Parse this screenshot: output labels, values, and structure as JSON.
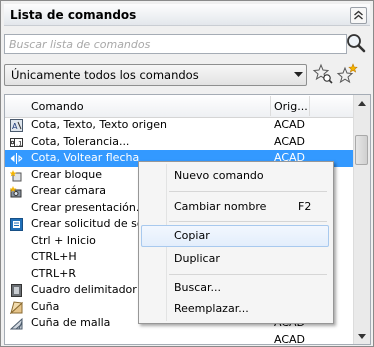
{
  "panel": {
    "title": "Lista de comandos"
  },
  "search": {
    "placeholder": "Buscar lista de comandos",
    "value": ""
  },
  "filter": {
    "selected": "Únicamente todos los comandos"
  },
  "list": {
    "columns": [
      "Comando",
      "Orig..."
    ],
    "rows": [
      {
        "command": "Cota, Texto, Texto origen",
        "origin": "ACAD",
        "icon": "dimension-text-icon"
      },
      {
        "command": "Cota, Tolerancia...",
        "origin": "ACAD",
        "icon": "tolerance-icon"
      },
      {
        "command": "Cota, Voltear flecha",
        "origin": "ACAD",
        "icon": "flip-arrow-icon",
        "selected": true
      },
      {
        "command": "Crear bloque",
        "origin": "",
        "icon": "create-block-icon"
      },
      {
        "command": "Crear cámara",
        "origin": "",
        "icon": "camera-icon"
      },
      {
        "command": "Crear presentación...",
        "origin": "",
        "icon": ""
      },
      {
        "command": "Crear solicitud de sopo",
        "origin": "",
        "icon": "support-request-icon"
      },
      {
        "command": "Ctrl + Inicio",
        "origin": "",
        "icon": ""
      },
      {
        "command": "CTRL+H",
        "origin": "",
        "icon": ""
      },
      {
        "command": "CTRL+R",
        "origin": "",
        "icon": ""
      },
      {
        "command": "Cuadro delimitador de g",
        "origin": "",
        "icon": "bounding-box-icon"
      },
      {
        "command": "Cuña",
        "origin": "",
        "icon": "wedge-icon"
      },
      {
        "command": "Cuña de malla",
        "origin": "ACAD",
        "icon": "mesh-wedge-icon"
      },
      {
        "command": "",
        "origin": "ACAD",
        "icon": ""
      }
    ]
  },
  "context_menu": {
    "items": [
      {
        "label": "Nuevo comando",
        "shortcut": ""
      },
      {
        "label": "Cambiar nombre",
        "shortcut": "F2"
      },
      {
        "label": "Copiar",
        "shortcut": ""
      },
      {
        "label": "Duplicar",
        "shortcut": ""
      },
      {
        "label": "Buscar...",
        "shortcut": ""
      },
      {
        "label": "Reemplazar...",
        "shortcut": ""
      }
    ]
  },
  "colors": {
    "selection": "#3399ff",
    "menu_hover_border": "#a8c9ee"
  }
}
